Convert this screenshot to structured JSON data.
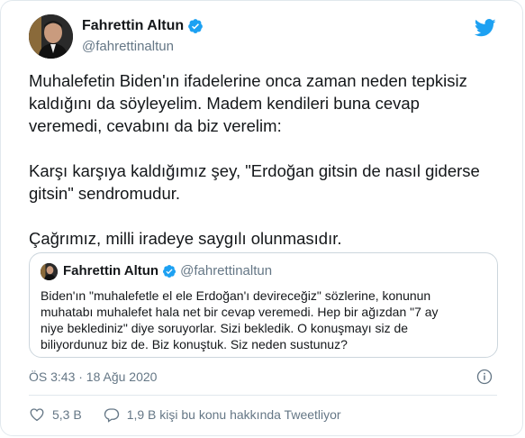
{
  "author": {
    "name": "Fahrettin Altun",
    "handle": "@fahrettinaltun"
  },
  "tweet": {
    "paragraphs": [
      "Muhalefetin Biden'ın ifadelerine onca zaman neden tepkisiz kaldığını da söyleyelim. Madem kendileri buna cevap veremedi, cevabını da biz verelim:",
      "Karşı karşıya kaldığımız şey, \"Erdoğan gitsin de nasıl giderse gitsin\" sendromudur.",
      "Çağrımız, milli iradeye saygılı olunmasıdır."
    ]
  },
  "quoted": {
    "name": "Fahrettin Altun",
    "handle": "@fahrettinaltun",
    "text": "Biden'ın \"muhalefetle el ele Erdoğan'ı devireceğiz\" sözlerine, konunun\nmuhatabı muhalefet hala net bir  cevap veremedi. Hep bir ağızdan \"7 ay\nniye beklediniz\" diye soruyorlar. Sizi bekledik. O konuşmayı siz de\nbiliyordunuz biz de. Biz konuştuk. Siz neden sustunuz?"
  },
  "timestamp": "ÖS 3:43 · 18 Ağu 2020",
  "actions": {
    "likes": "5,3 B",
    "replies": "1,9 B kişi bu konu hakkında Tweetliyor"
  },
  "colors": {
    "accent": "#1da1f2",
    "text": "#14171a",
    "muted": "#657786",
    "border": "#e1e8ed"
  }
}
